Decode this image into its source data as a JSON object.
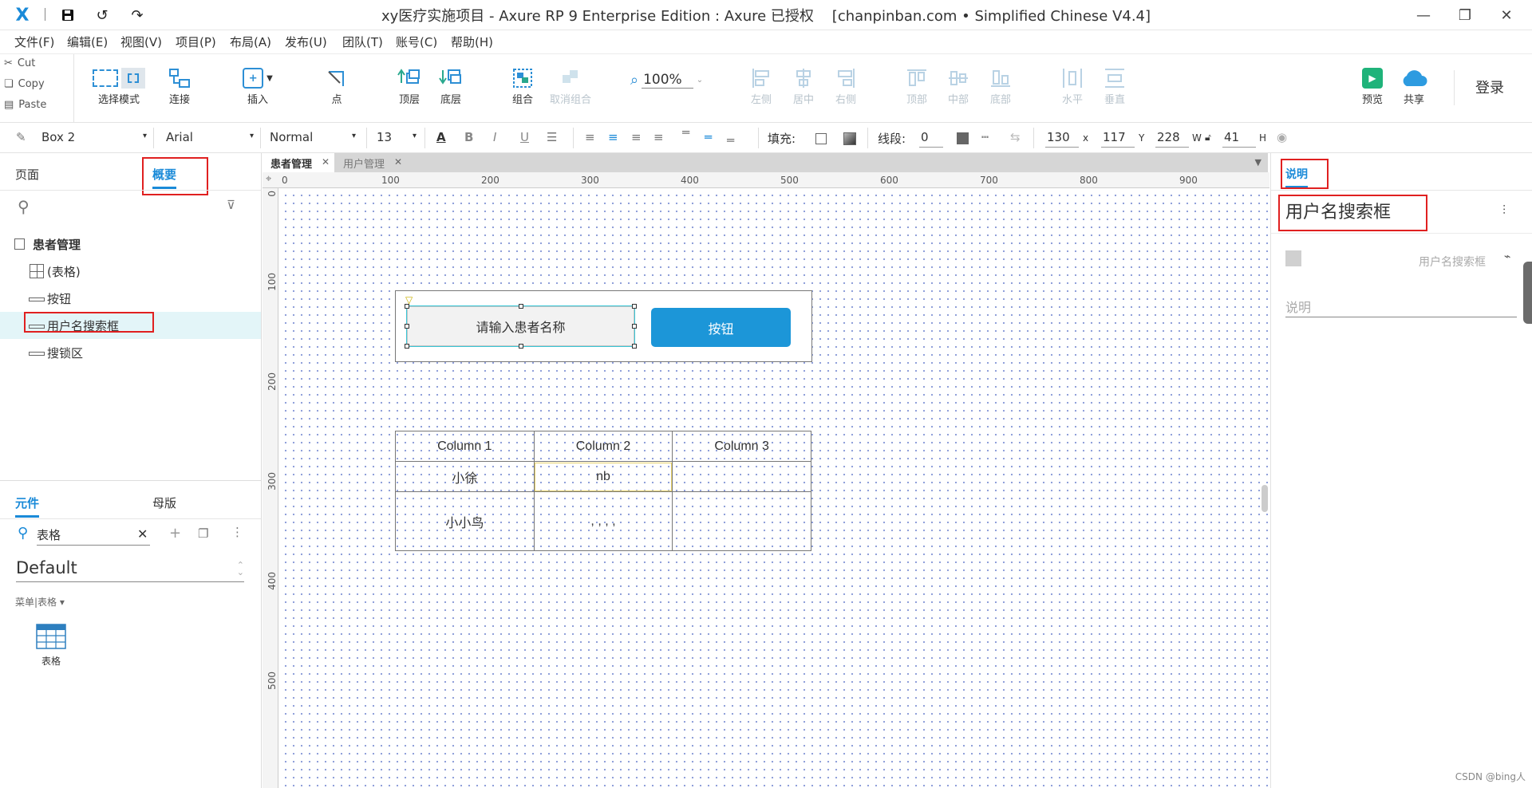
{
  "titlebar": {
    "title": "xy医疗实施项目 - Axure RP 9 Enterprise Edition : Axure 已授权    [chanpinban.com • Simplified Chinese V4.4]"
  },
  "menu": [
    "文件(F)",
    "编辑(E)",
    "视图(V)",
    "项目(P)",
    "布局(A)",
    "发布(U)",
    "团队(T)",
    "账号(C)",
    "帮助(H)"
  ],
  "clipboard": {
    "cut": "Cut",
    "copy": "Copy",
    "paste": "Paste"
  },
  "toolbar": {
    "select_mode": "选择模式",
    "connect": "连接",
    "insert": "插入",
    "point": "点",
    "top_layer": "顶层",
    "bottom_layer": "底层",
    "group": "组合",
    "ungroup": "取消组合",
    "zoom": "100%",
    "align_left": "左侧",
    "align_center": "居中",
    "align_right": "右侧",
    "align_top": "顶部",
    "align_middle": "中部",
    "align_bottom": "底部",
    "distribute_h": "水平",
    "distribute_v": "垂直",
    "preview": "预览",
    "share": "共享",
    "login": "登录"
  },
  "format": {
    "style": "Box 2",
    "font": "Arial",
    "weight": "Normal",
    "size": "13",
    "fill_label": "填充:",
    "line_label": "线段:",
    "line_value": "0",
    "x": "130",
    "x_label": "x",
    "y": "117",
    "y_label": "Y",
    "w": "228",
    "w_label": "W",
    "h": "41",
    "h_label": "H"
  },
  "left": {
    "tab_pages": "页面",
    "tab_outline": "概要",
    "outline_root": "患者管理",
    "outline_items": [
      "(表格)",
      "按钮",
      "用户名搜索框",
      "搜锁区"
    ],
    "tab_widgets": "元件",
    "tab_masters": "母版",
    "search_value": "表格",
    "library": "Default",
    "category": "菜单|表格 ▾",
    "widget_label": "表格"
  },
  "doc_tabs": [
    "患者管理",
    "用户管理"
  ],
  "rulers": {
    "h": [
      "0",
      "100",
      "200",
      "300",
      "400",
      "500",
      "600",
      "700",
      "800",
      "900"
    ],
    "v": [
      "0",
      "100",
      "200",
      "300",
      "400",
      "500"
    ]
  },
  "canvas": {
    "search_placeholder": "请输入患者名称",
    "button_label": "按钮",
    "table_headers": [
      "Column 1",
      "Column 2",
      "Column 3"
    ],
    "table_rows": [
      [
        "小徐",
        "nb",
        ""
      ],
      [
        "小小鸟",
        ", , , ,",
        ""
      ]
    ]
  },
  "right": {
    "tab_notes": "说明",
    "widget_name": "用户名搜索框",
    "widget_subname": "用户名搜索框",
    "notes_placeholder": "说明"
  },
  "watermark": "CSDN @bing人",
  "colors": {
    "accent": "#1a8ad8",
    "button": "#1c96d8",
    "highlight": "#e02020",
    "selection_row": "#e3f5f8"
  }
}
